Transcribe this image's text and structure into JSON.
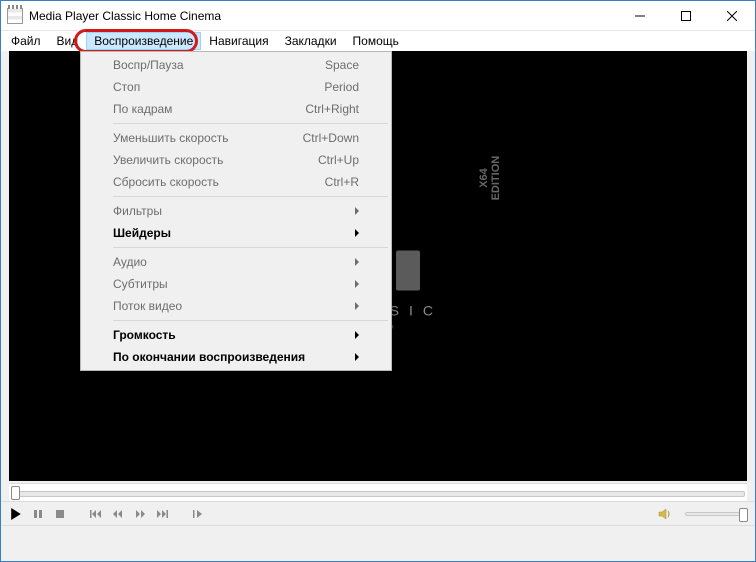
{
  "window": {
    "title": "Media Player Classic Home Cinema"
  },
  "menubar": {
    "items": [
      {
        "label": "Файл"
      },
      {
        "label": "Вид"
      },
      {
        "label": "Воспроизведение"
      },
      {
        "label": "Навигация"
      },
      {
        "label": "Закладки"
      },
      {
        "label": "Помощь"
      }
    ]
  },
  "dropdown": {
    "groups": [
      [
        {
          "label": "Воспр/Пауза",
          "accel": "Space",
          "enabled": false,
          "submenu": false
        },
        {
          "label": "Стоп",
          "accel": "Period",
          "enabled": false,
          "submenu": false
        },
        {
          "label": "По кадрам",
          "accel": "Ctrl+Right",
          "enabled": false,
          "submenu": false
        }
      ],
      [
        {
          "label": "Уменьшить скорость",
          "accel": "Ctrl+Down",
          "enabled": false,
          "submenu": false
        },
        {
          "label": "Увеличить скорость",
          "accel": "Ctrl+Up",
          "enabled": false,
          "submenu": false
        },
        {
          "label": "Сбросить скорость",
          "accel": "Ctrl+R",
          "enabled": false,
          "submenu": false
        }
      ],
      [
        {
          "label": "Фильтры",
          "accel": "",
          "enabled": false,
          "submenu": true
        },
        {
          "label": "Шейдеры",
          "accel": "",
          "enabled": true,
          "submenu": true
        }
      ],
      [
        {
          "label": "Аудио",
          "accel": "",
          "enabled": false,
          "submenu": true
        },
        {
          "label": "Субтитры",
          "accel": "",
          "enabled": false,
          "submenu": true
        },
        {
          "label": "Поток видео",
          "accel": "",
          "enabled": false,
          "submenu": true
        }
      ],
      [
        {
          "label": "Громкость",
          "accel": "",
          "enabled": true,
          "submenu": true
        },
        {
          "label": "По окончании воспроизведения",
          "accel": "",
          "enabled": true,
          "submenu": true
        }
      ]
    ]
  },
  "logo": {
    "line1": "CLASSIC",
    "line2": "EMA",
    "edition1": "X64",
    "edition2": "EDITION"
  },
  "controls": {
    "play_enabled": true
  }
}
